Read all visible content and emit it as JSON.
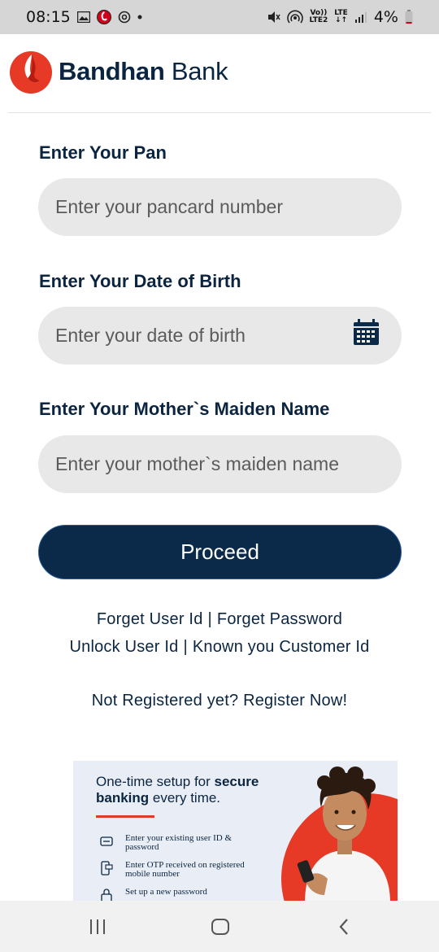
{
  "status_bar": {
    "time": "08:15",
    "left_icons": [
      "gallery-icon",
      "vodafone-icon",
      "sync-icon",
      "dot-icon"
    ],
    "right_icons": [
      "mute-icon",
      "hotspot-icon",
      "volte-icon",
      "lte-icon",
      "signal-icon"
    ],
    "volte_text_top": "Vo))",
    "volte_text_bottom": "LTE2",
    "lte_text": "LTE",
    "battery": "4%"
  },
  "header": {
    "brand_bold": "Bandhan",
    "brand_rest": " Bank"
  },
  "form": {
    "pan_label": "Enter Your Pan",
    "pan_placeholder": "Enter your pancard number",
    "dob_label": "Enter Your Date of Birth",
    "dob_placeholder": "Enter your date of birth",
    "maiden_label": "Enter Your Mother`s Maiden Name",
    "maiden_placeholder": "Enter your mother`s maiden name",
    "proceed_label": "Proceed"
  },
  "links": {
    "forget_user_id": "Forget User Id",
    "forget_password": "Forget Password",
    "unlock_user_id": "Unlock User Id",
    "known_customer_id": "Known you Customer Id",
    "separator": "|",
    "not_registered": "Not Registered yet?",
    "register_now": "Register Now!"
  },
  "promo": {
    "title_part1": "One-time setup for ",
    "title_bold1": "secure",
    "title_bold2": "banking",
    "title_part2": " every time.",
    "steps": [
      "Enter your existing user ID & password",
      "Enter OTP received on registered mobile number",
      "Set up a new password"
    ]
  },
  "colors": {
    "brand_navy": "#0b2a4a",
    "brand_red": "#e63a26",
    "input_bg": "#e8e8e8"
  }
}
